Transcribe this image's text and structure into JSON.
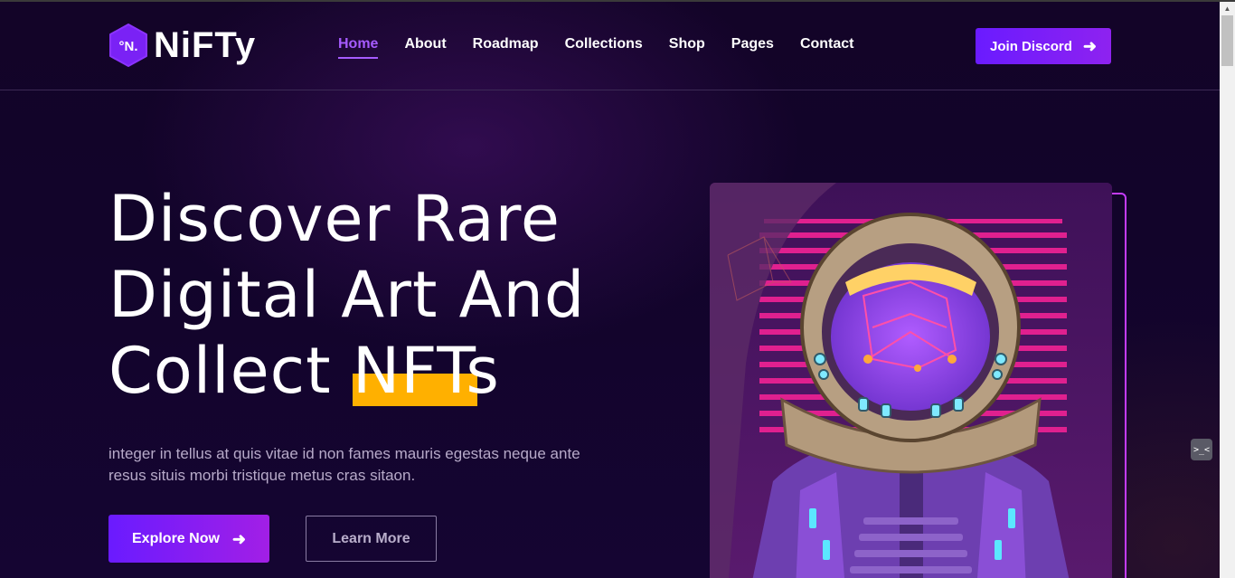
{
  "brand": {
    "logo_mark": "°N.",
    "name": "NiFTy"
  },
  "nav": {
    "items": [
      {
        "label": "Home",
        "active": true
      },
      {
        "label": "About"
      },
      {
        "label": "Roadmap"
      },
      {
        "label": "Collections"
      },
      {
        "label": "Shop"
      },
      {
        "label": "Pages"
      },
      {
        "label": "Contact"
      }
    ]
  },
  "header": {
    "cta_label": "Join Discord"
  },
  "hero": {
    "title_lines": [
      "Discover Rare",
      "Digital Art And",
      "Collect NFTs"
    ],
    "description": "integer in tellus at quis vitae id non fames mauris egestas neque ante resus situis morbi tristique metus cras sitaon.",
    "primary_button": "Explore Now",
    "secondary_button": "Learn More"
  },
  "icons": {
    "arrow": "arrow-right-icon",
    "widget": "code-widget-icon"
  },
  "widget": {
    "label": ">_<"
  },
  "colors": {
    "accent": "#7a1fff",
    "highlight": "#ffb000",
    "background": "#12042a"
  }
}
